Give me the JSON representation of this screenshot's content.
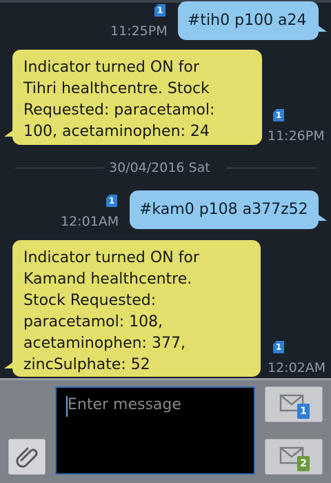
{
  "messages": [
    {
      "type": "outgoing",
      "text": "#tih0 p100 a24",
      "time": "11:25PM",
      "sim": "1"
    },
    {
      "type": "incoming",
      "lines": [
        "Indicator turned ON for",
        "Tihri healthcentre. Stock",
        "Requested: paracetamol:",
        "100, acetaminophen: 24"
      ],
      "time": "11:26PM",
      "sim": "1"
    },
    {
      "type": "outgoing",
      "text": "#kam0 p108 a377z52",
      "time": "12:01AM",
      "sim": "1"
    },
    {
      "type": "incoming",
      "lines": [
        "Indicator turned ON for",
        "Kamand healthcentre.",
        "Stock Requested:",
        "paracetamol: 108,",
        "acetaminophen: 377,",
        "zincSulphate: 52"
      ],
      "time": "12:02AM",
      "sim": "1"
    }
  ],
  "date_divider": "30/04/2016 Sat",
  "composer": {
    "placeholder": "Enter message",
    "send_sim1_badge": "1",
    "send_sim2_badge": "2"
  },
  "colors": {
    "background": "#1b2128",
    "incoming_bubble": "#e2df6a",
    "outgoing_bubble": "#8ec8ef",
    "sim1": "#2f7fd6",
    "sim2": "#6a9a3a"
  },
  "icons": {
    "attach": "paperclip-icon",
    "send": "envelope-send-icon",
    "sim": "sim-card-icon"
  }
}
